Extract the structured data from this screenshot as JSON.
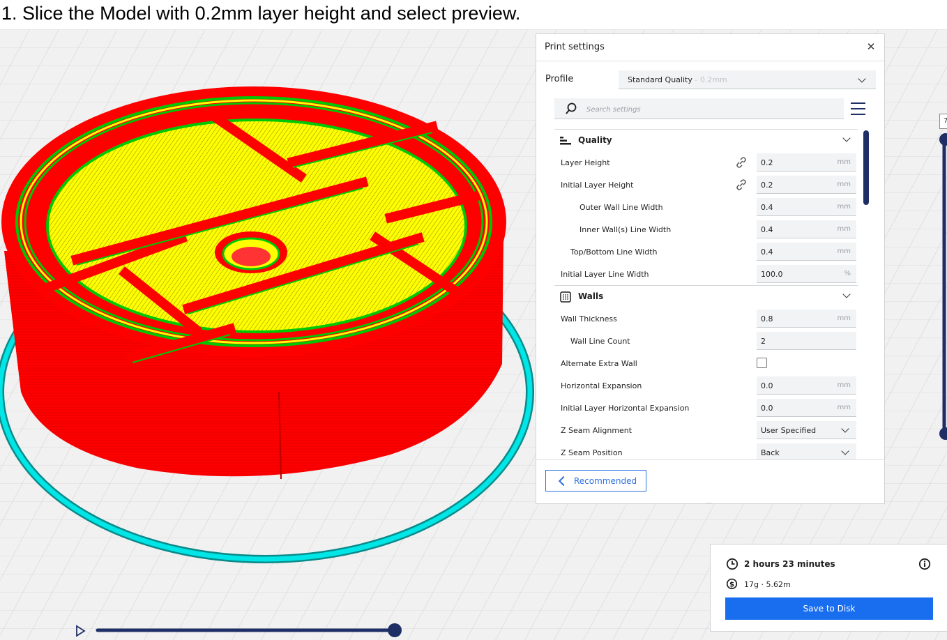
{
  "instruction": "1. Slice the Model with 0.2mm layer height and select preview.",
  "panel": {
    "title": "Print settings",
    "profile_label": "Profile",
    "profile_value": "Standard Quality",
    "profile_sub": " - 0.2mm",
    "search_placeholder": "Search settings"
  },
  "categories": {
    "quality": {
      "title": "Quality",
      "icon": "quality-icon"
    },
    "walls": {
      "title": "Walls",
      "icon": "walls-grid-icon"
    }
  },
  "settings": {
    "layer_height": {
      "label": "Layer Height",
      "value": "0.2",
      "unit": "mm"
    },
    "initial_layer_height": {
      "label": "Initial Layer Height",
      "value": "0.2",
      "unit": "mm"
    },
    "outer_wall_line_width": {
      "label": "Outer Wall Line Width",
      "value": "0.4",
      "unit": "mm"
    },
    "inner_wall_line_width": {
      "label": "Inner Wall(s) Line Width",
      "value": "0.4",
      "unit": "mm"
    },
    "top_bottom_line_width": {
      "label": "Top/Bottom Line Width",
      "value": "0.4",
      "unit": "mm"
    },
    "initial_layer_line_width": {
      "label": "Initial Layer Line Width",
      "value": "100.0",
      "unit": "%"
    },
    "wall_thickness": {
      "label": "Wall Thickness",
      "value": "0.8",
      "unit": "mm"
    },
    "wall_line_count": {
      "label": "Wall Line Count",
      "value": "2"
    },
    "alternate_extra_wall": {
      "label": "Alternate Extra Wall",
      "checked": false
    },
    "horizontal_expansion": {
      "label": "Horizontal Expansion",
      "value": "0.0",
      "unit": "mm"
    },
    "initial_layer_horizontal_expansion": {
      "label": "Initial Layer Horizontal Expansion",
      "value": "0.0",
      "unit": "mm"
    },
    "z_seam_alignment": {
      "label": "Z Seam Alignment",
      "value": "User Specified"
    },
    "z_seam_position": {
      "label": "Z Seam Position",
      "value": "Back"
    }
  },
  "footer": {
    "recommended_label": "Recommended"
  },
  "estimate": {
    "time": "2 hours 23 minutes",
    "material": "17g · 5.62m",
    "save_label": "Save to Disk"
  },
  "layer_view": {
    "top_layer_number": "7"
  },
  "colors": {
    "accent": "#196ef0",
    "wall_red": "#ff0000",
    "infill_yellow": "#ffff00",
    "inner_wall_green": "#00c800",
    "skirt_cyan": "#00e5e5",
    "slider_navy": "#1f2f66"
  }
}
